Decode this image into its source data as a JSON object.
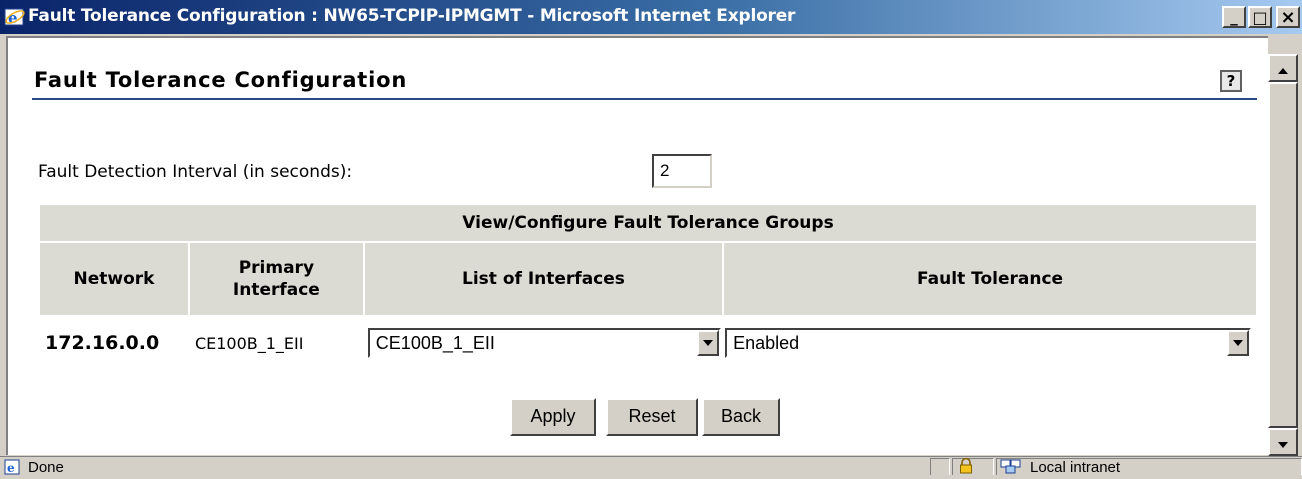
{
  "window": {
    "title": "Fault Tolerance Configuration : NW65-TCPIP-IPMGMT - Microsoft Internet Explorer",
    "minimize_label": "_",
    "maximize_label": "□",
    "close_label": "×"
  },
  "page": {
    "title": "Fault Tolerance Configuration",
    "help_label": "?"
  },
  "fault_detection": {
    "label": "Fault Detection Interval (in seconds):",
    "value": "2"
  },
  "groups_table": {
    "group_header": "View/Configure Fault Tolerance Groups",
    "columns": {
      "network": "Network",
      "primary_line1": "Primary",
      "primary_line2": "Interface",
      "interfaces": "List of Interfaces",
      "fault_tolerance": "Fault Tolerance"
    },
    "rows": [
      {
        "network": "172.16.0.0",
        "primary_interface": "CE100B_1_EII",
        "interface_selected": "CE100B_1_EII",
        "fault_tolerance_selected": "Enabled"
      }
    ]
  },
  "buttons": {
    "apply": "Apply",
    "reset": "Reset",
    "back": "Back"
  },
  "status": {
    "text": "Done",
    "zone": "Local intranet"
  },
  "colors": {
    "titlebar_start": "#0a246a",
    "titlebar_end": "#a6caf0",
    "table_header_bg": "#dcdbd3",
    "title_rule": "#2a4a8a"
  }
}
